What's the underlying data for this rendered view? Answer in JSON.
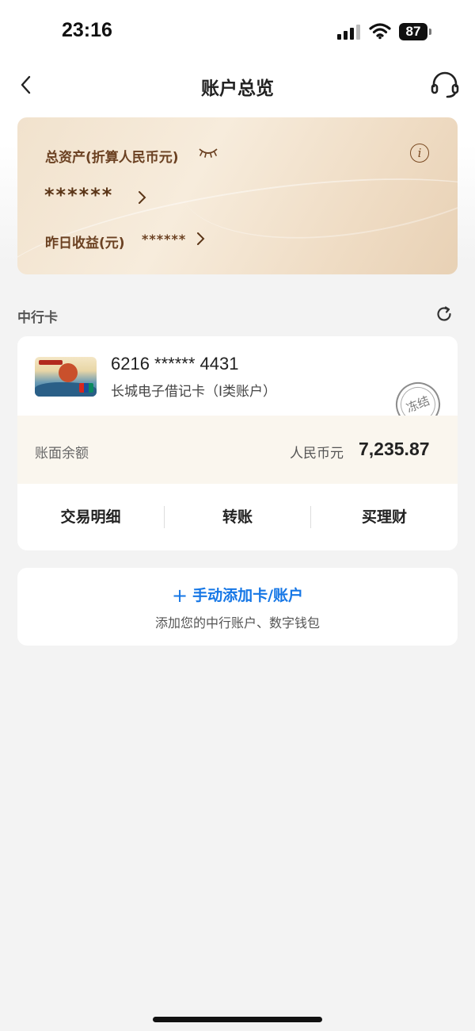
{
  "status_bar": {
    "time": "23:16",
    "battery": "87"
  },
  "nav": {
    "title": "账户总览"
  },
  "assets": {
    "label": "总资产(折算人民币元)",
    "value": "******",
    "yesterday_label": "昨日收益(元)",
    "yesterday_value": "******"
  },
  "section": {
    "title": "中行卡"
  },
  "card": {
    "number": "6216 ****** 4431",
    "type": "长城电子借记卡（I类账户）",
    "status_stamp": "冻结",
    "balance_label": "账面余额",
    "currency": "人民币元",
    "balance": "7,235.87",
    "actions": [
      "交易明细",
      "转账",
      "买理财"
    ]
  },
  "add_card": {
    "title": "手动添加卡/账户",
    "subtitle": "添加您的中行账户、数字钱包"
  },
  "colors": {
    "accent_blue": "#1677e6",
    "gold_text": "#6b4122",
    "card_gradient": "#f1e2cd"
  }
}
